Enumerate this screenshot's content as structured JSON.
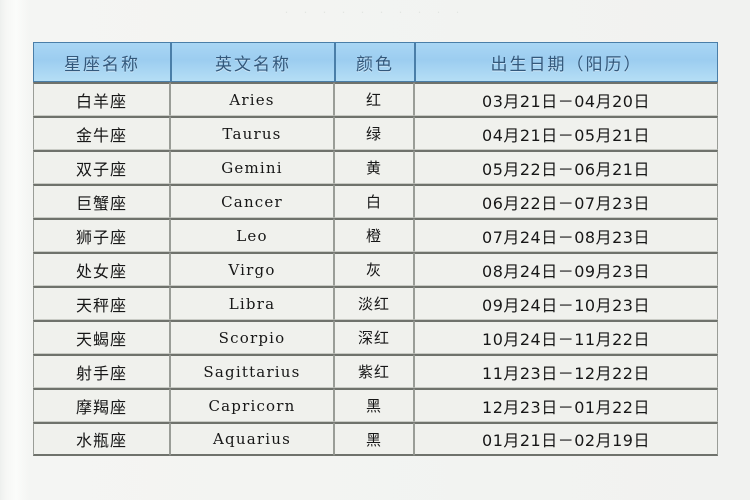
{
  "page": {
    "background_color": "#f2f3f1",
    "top_faint_text": "· · · · ·   · ·   · · ·"
  },
  "table": {
    "header_background": "#9ccdf0",
    "header_border_color": "#4a7ea8",
    "header_text_color": "#2a4e72",
    "cell_background": "#f0f1ed",
    "columns": [
      {
        "key": "name_cn",
        "label": "星座名称"
      },
      {
        "key": "name_en",
        "label": "英文名称"
      },
      {
        "key": "color",
        "label": "颜色"
      },
      {
        "key": "date",
        "label": "出生日期（阳历）"
      }
    ],
    "rows": [
      {
        "name_cn": "白羊座",
        "name_en": "Aries",
        "color": "红",
        "date": "03月21日－04月20日"
      },
      {
        "name_cn": "金牛座",
        "name_en": "Taurus",
        "color": "绿",
        "date": "04月21日－05月21日"
      },
      {
        "name_cn": "双子座",
        "name_en": "Gemini",
        "color": "黄",
        "date": "05月22日－06月21日"
      },
      {
        "name_cn": "巨蟹座",
        "name_en": "Cancer",
        "color": "白",
        "date": "06月22日－07月23日"
      },
      {
        "name_cn": "狮子座",
        "name_en": "Leo",
        "color": "橙",
        "date": "07月24日－08月23日"
      },
      {
        "name_cn": "处女座",
        "name_en": "Virgo",
        "color": "灰",
        "date": "08月24日－09月23日"
      },
      {
        "name_cn": "天秤座",
        "name_en": "Libra",
        "color": "淡红",
        "date": "09月24日－10月23日"
      },
      {
        "name_cn": "天蝎座",
        "name_en": "Scorpio",
        "color": "深红",
        "date": "10月24日－11月22日"
      },
      {
        "name_cn": "射手座",
        "name_en": "Sagittarius",
        "color": "紫红",
        "date": "11月23日－12月22日"
      },
      {
        "name_cn": "摩羯座",
        "name_en": "Capricorn",
        "color": "黑",
        "date": "12月23日－01月22日"
      },
      {
        "name_cn": "水瓶座",
        "name_en": "Aquarius",
        "color": "黑",
        "date": "01月21日－02月19日"
      }
    ]
  }
}
